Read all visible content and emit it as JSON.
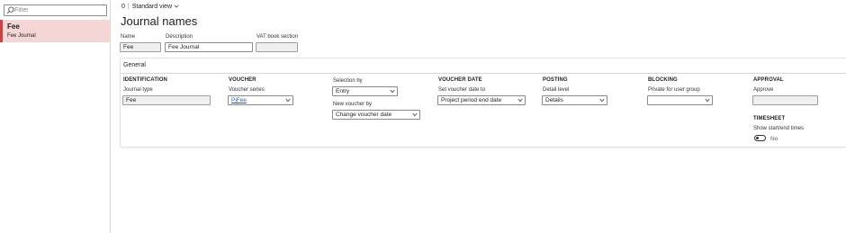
{
  "list": {
    "filter_placeholder": "Filter",
    "record": {
      "title": "Fee",
      "subtitle": "Fee Journal"
    }
  },
  "header": {
    "count": "0",
    "separator": "|",
    "view": "Standard view",
    "title": "Journal names"
  },
  "top_fields": {
    "name_label": "Name",
    "name_value": "Fee",
    "description_label": "Description",
    "description_value": "Fee Journal",
    "vat_label": "VAT book section",
    "vat_value": ""
  },
  "general": {
    "header": "General",
    "identification": {
      "heading": "IDENTIFICATION",
      "journal_type_label": "Journal type",
      "journal_type_value": "Fee"
    },
    "voucher": {
      "heading": "VOUCHER",
      "series_label": "Voucher series",
      "series_value": "PjFee"
    },
    "selection": {
      "selection_label": "Selection by",
      "selection_value": "Entry",
      "new_voucher_label": "New voucher by",
      "new_voucher_value": "Change voucher date"
    },
    "voucher_date": {
      "heading": "VOUCHER DATE",
      "set_label": "Set voucher date to",
      "set_value": "Project period end date"
    },
    "posting": {
      "heading": "POSTING",
      "detail_label": "Detail level",
      "detail_value": "Details"
    },
    "blocking": {
      "heading": "BLOCKING",
      "private_label": "Private for user group",
      "private_value": ""
    },
    "approval": {
      "heading": "APPROVAL",
      "approve_label": "Approve",
      "approve_value": ""
    },
    "timesheet": {
      "heading": "TIMESHEET",
      "show_label": "Show start/end times",
      "toggle_value": "No"
    }
  },
  "colors": {
    "accent": "#c9433e",
    "selected_bg": "#f3d6d5",
    "link": "#2b5fb1"
  }
}
